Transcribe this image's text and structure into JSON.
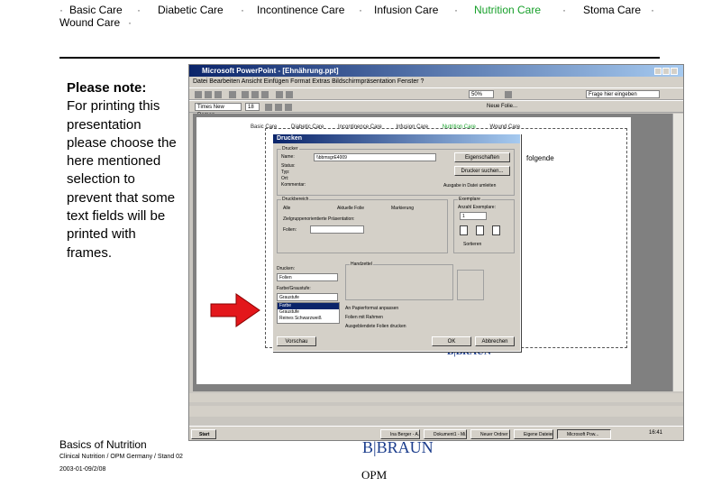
{
  "nav": {
    "items": [
      {
        "label": "Basic Care"
      },
      {
        "label": "Diabetic Care"
      },
      {
        "label": "Incontinence Care"
      },
      {
        "label": "Infusion Care"
      },
      {
        "label": "Nutrition Care"
      },
      {
        "label": "Stoma Care"
      },
      {
        "label": "Wound Care"
      }
    ],
    "active": "Nutrition Care",
    "active_color": "#17a02a"
  },
  "note": {
    "heading": "Please note:",
    "body": "For printing this presentation please choose the here mentioned selection to prevent that some text fields will be printed with frames."
  },
  "screenshot": {
    "window_title": "Microsoft PowerPoint - [Ehnährung.ppt]",
    "menu": "Datei  Bearbeiten  Ansicht  Einfügen  Format  Extras  Bildschirmpräsentation  Fenster  ?",
    "font_name": "Times New Roman",
    "font_size": "18",
    "zoom": "50%",
    "new_slide": "Neue Folie...",
    "help_box": "Frage hier eingeben",
    "slide_nav": [
      "Basic Care",
      "Diabetic Care",
      "Incontinence Care",
      "Infusion Care",
      "Nutrition Care",
      "Wound Care"
    ],
    "slide_folgende": "folgende",
    "slide_brand": "B|BRAUN",
    "dialog": {
      "title": "Drucken",
      "printer_group": "Drucker",
      "name_label": "Name:",
      "name_value": "\\\\bbmsgrE4009",
      "properties_btn": "Eigenschaften",
      "status_lines": [
        "Status:",
        "Typ:",
        "Ort:",
        "Kommentar:"
      ],
      "find_printer_btn": "Drucker suchen...",
      "print_to_file": "Ausgabe in Datei umleiten",
      "range_group": "Druckbereich",
      "range_all": "Alle",
      "range_current": "Aktuelle Folie",
      "range_selection": "Markierung",
      "range_custom": "Zielgruppenorientierte Präsentation:",
      "range_slides": "Folien:",
      "copies_group": "Exemplare",
      "copies_label": "Anzahl Exemplare:",
      "copies_value": "1",
      "collate": "Sortieren",
      "print_what_label": "Drucken:",
      "print_what_value": "Folien",
      "color_label": "Farbe/Graustufe:",
      "color_value": "Graustufe",
      "list_options": [
        "Farbe",
        "Graustufe",
        "Reines Schwarzweiß"
      ],
      "handouts_group": "Handzettel",
      "scale_to_fit": "An Papierformat anpassen",
      "frame_slides": "Folien mit Rahmen",
      "print_hidden": "Ausgeblendete Folien drucken",
      "preview_btn": "Vorschau",
      "ok_btn": "OK",
      "cancel_btn": "Abbrechen"
    },
    "taskbar": {
      "start": "Start",
      "tasks": [
        "Ina Berger - A...",
        "Dokument1 - Mi...",
        "Neuer Ordner",
        "Eigene Dateien",
        "Microsoft Pow..."
      ],
      "clock": "16:41"
    }
  },
  "footer": {
    "title": "Basics of Nutrition",
    "subtitle": "Clinical Nutrition / OPM Germany / Stand 02",
    "date": "2003-01-09/2/08",
    "brand": "B|BRAUN",
    "brand_color": "#1a3c8c",
    "org": "OPM"
  },
  "colors": {
    "arrow": "#e3171b",
    "titlebar": "#0a246a"
  }
}
